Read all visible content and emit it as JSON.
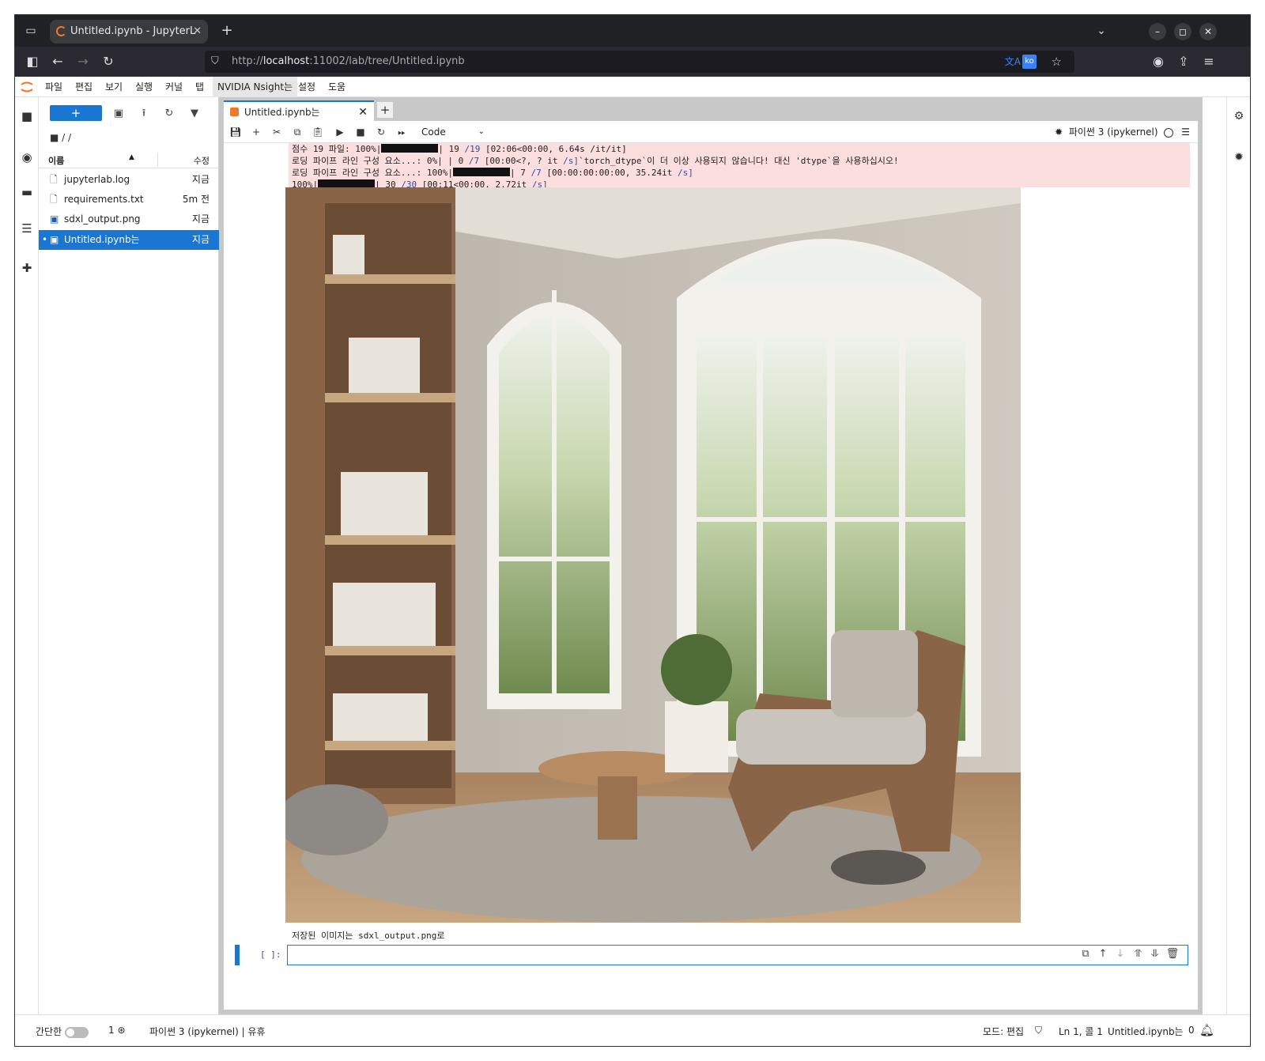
{
  "browser": {
    "tab_title": "Untitled.ipynb - JupyterL",
    "url_prefix": "http://",
    "url_host": "localhost",
    "url_rest": ":11002/lab/tree/Untitled.ipynb",
    "translate_lang": "ko"
  },
  "menubar": [
    "파일",
    "편집",
    "보기",
    "실행",
    "커널",
    "탭",
    "NVIDIA Nsight는",
    "설정",
    "도움"
  ],
  "filebrowser": {
    "breadcrumb": "/ /",
    "col_name": "이름",
    "col_modified": "수정",
    "files": [
      {
        "name": "jupyterlab.log",
        "time": "지금",
        "icon": "file-icon"
      },
      {
        "name": "requirements.txt",
        "time": "5m 전",
        "icon": "file-icon"
      },
      {
        "name": "sdxl_output.png",
        "time": "지금",
        "icon": "image-icon"
      },
      {
        "name": "Untitled.ipynb는",
        "time": "지금",
        "icon": "notebook-icon",
        "selected": true
      }
    ]
  },
  "notebook": {
    "tab_label": "Untitled.ipynb는",
    "cell_type": "Code",
    "kernel": "파이썬 3 (ipykernel)",
    "stderr": {
      "line1a": "점수 19 파일: 100%|",
      "line1b": "| 19 ",
      "line1c": "/19",
      "line1d": " [02:06<00:00, 6.64s /it/it]",
      "line2a": "로딩 파이프 라인 구성 요소...: 0%| | 0 ",
      "line2b": "/7",
      "line2c": " [00:00<?, ? it ",
      "line2d": "/s]",
      "line2e": "`torch_dtype`이 더 이상 사용되지 않습니다! 대신 'dtype`을 사용하십시오!",
      "line3a": "로딩 파이프 라인 구성 요소...: 100%|",
      "line3b": "| 7 ",
      "line3c": "/7",
      "line3d": " [00:00:00:00:00, 35.24it ",
      "line3e": "/s]",
      "line4a": "100%|",
      "line4b": "| 30 ",
      "line4c": "/30",
      "line4d": " [00:11<00:00, 2.72it ",
      "line4e": "/s]"
    },
    "saved_text": "저장된 이미지는 sdxl_output.png로",
    "prompt": "[ ]:"
  },
  "statusbar": {
    "simple": "간단한",
    "terminals": "1",
    "kernel_status": "파이썬 3 (ipykernel) | 유휴",
    "mode": "모드: 편집",
    "position": "Ln 1, 콜 1",
    "file": "Untitled.ipynb는",
    "notifications": "0"
  },
  "colors": {
    "accent": "#1976d2",
    "jupyter_orange": "#f37626",
    "stderr_bg": "#fddede"
  }
}
